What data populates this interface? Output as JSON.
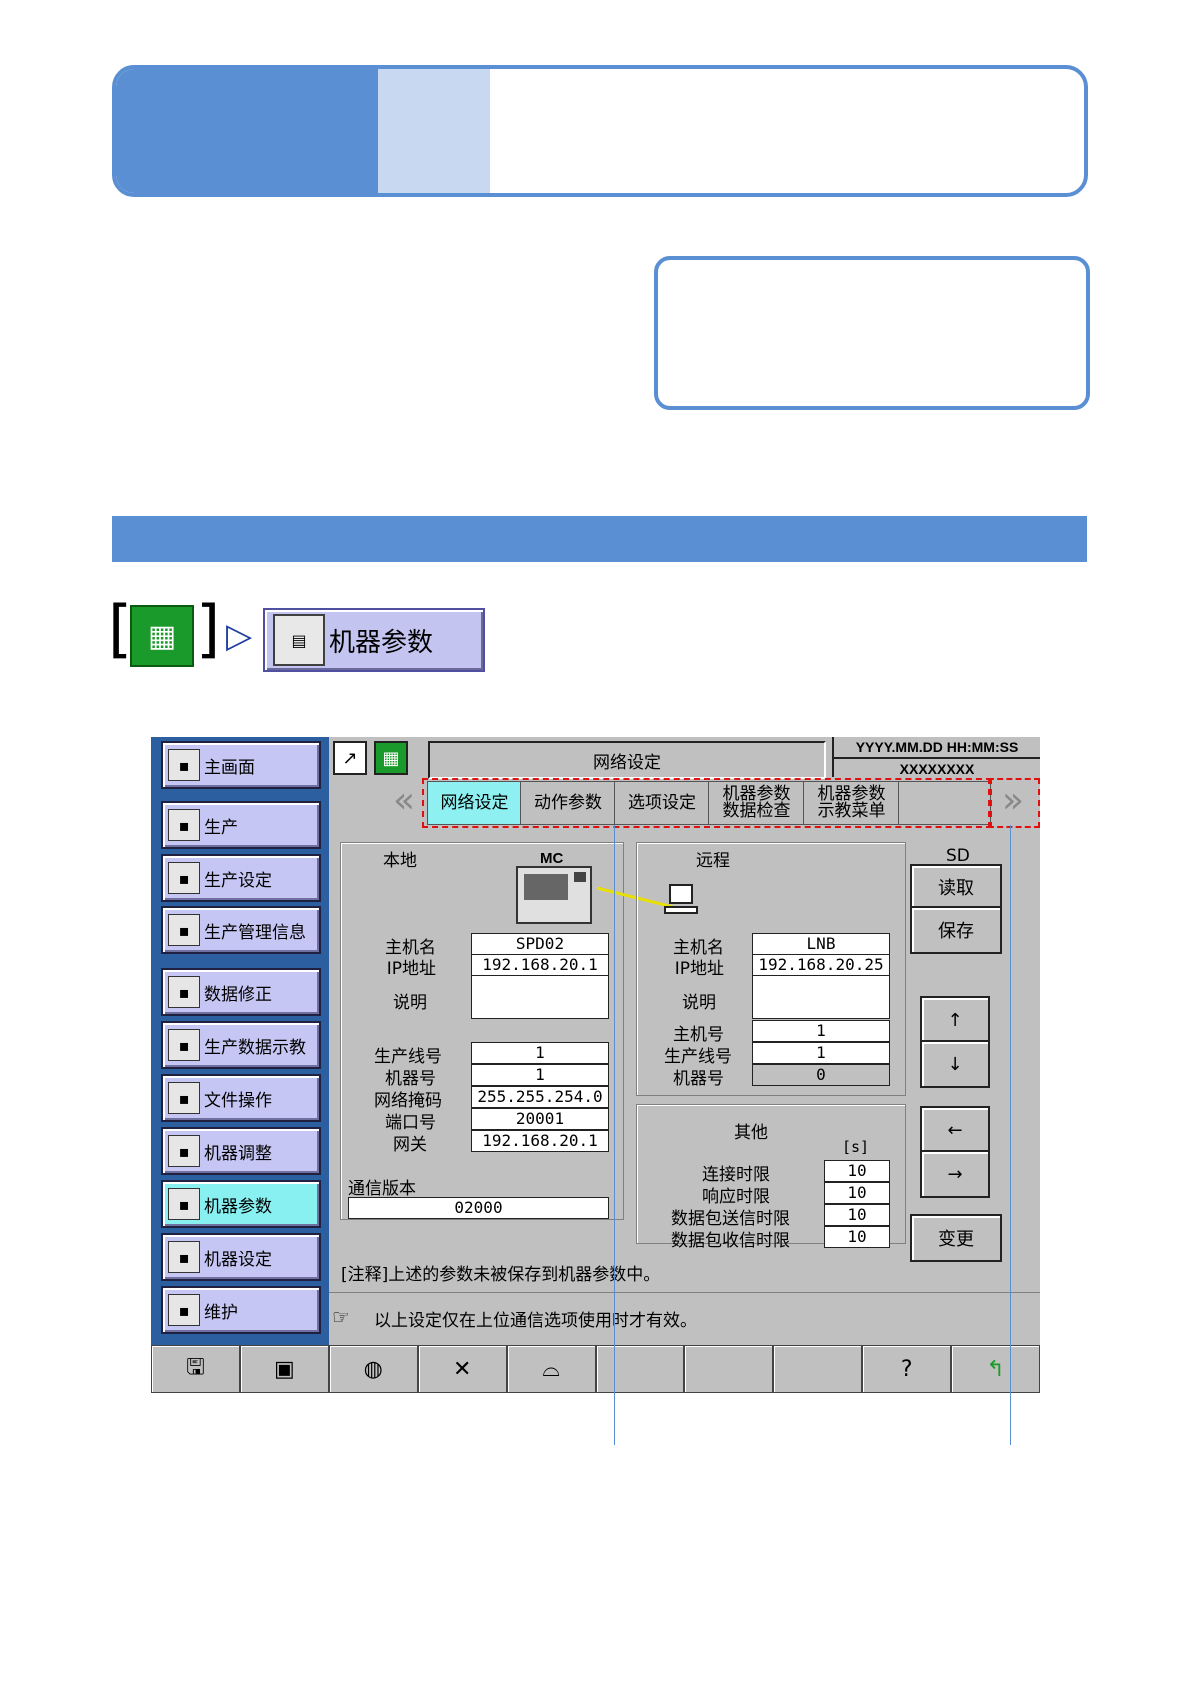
{
  "breadcrumb": {
    "target": "机器参数"
  },
  "screen": {
    "title": "网络设定",
    "date": "YYYY.MM.DD HH:MM:SS",
    "machine": "XXXXXXXX",
    "tabs": [
      "网络设定",
      "动作参数",
      "选项设定",
      "机器参数\n数据检查",
      "机器参数\n示教菜单"
    ],
    "sidebar": [
      {
        "label": "主画面",
        "icon": "home-icon"
      },
      {
        "label": "生产",
        "icon": "production-icon"
      },
      {
        "label": "生产设定",
        "icon": "production-settings-icon"
      },
      {
        "label": "生产管理信息",
        "icon": "production-info-icon"
      },
      {
        "label": "数据修正",
        "icon": "data-edit-icon"
      },
      {
        "label": "生产数据示教",
        "icon": "teach-icon"
      },
      {
        "label": "文件操作",
        "icon": "floppy-icon"
      },
      {
        "label": "机器调整",
        "icon": "machine-adjust-icon"
      },
      {
        "label": "机器参数",
        "icon": "machine-param-icon"
      },
      {
        "label": "机器设定",
        "icon": "machine-setting-icon"
      },
      {
        "label": "维护",
        "icon": "clock-icon"
      }
    ],
    "local": {
      "title": "本地",
      "mc_label": "MC",
      "labels": {
        "host": "主机名",
        "ip": "IP地址",
        "desc": "说明",
        "line": "生产线号",
        "machine": "机器号",
        "mask": "网络掩码",
        "port": "端口号",
        "gateway": "网关"
      },
      "host": "SPD02",
      "ip": "192.168.20.1",
      "desc": "",
      "line": "1",
      "machine": "1",
      "mask": "255.255.254.0",
      "port": "20001",
      "gateway": "192.168.20.1",
      "version_label": "通信版本",
      "version": "02000"
    },
    "remote": {
      "title": "远程",
      "labels": {
        "host": "主机名",
        "ip": "IP地址",
        "desc": "说明",
        "hostno": "主机号",
        "line": "生产线号",
        "machine": "机器号"
      },
      "host": "LNB",
      "ip": "192.168.20.25",
      "desc": "",
      "hostno": "1",
      "line": "1",
      "machine": "0"
    },
    "other": {
      "title": "其他",
      "unit": "[s]",
      "rows": [
        {
          "label": "连接时限",
          "value": "10"
        },
        {
          "label": "响应时限",
          "value": "10"
        },
        {
          "label": "数据包送信时限",
          "value": "10"
        },
        {
          "label": "数据包收信时限",
          "value": "10"
        }
      ]
    },
    "sd": {
      "title": "SD",
      "read": "读取",
      "save": "保存"
    },
    "arrows": {
      "up": "↑",
      "down": "↓",
      "left": "←",
      "right": "→"
    },
    "change": "变更",
    "note": "[注释]上述的参数未被保存到机器参数中。",
    "hint": "以上设定仅在上位通信选项使用时才有效。"
  }
}
